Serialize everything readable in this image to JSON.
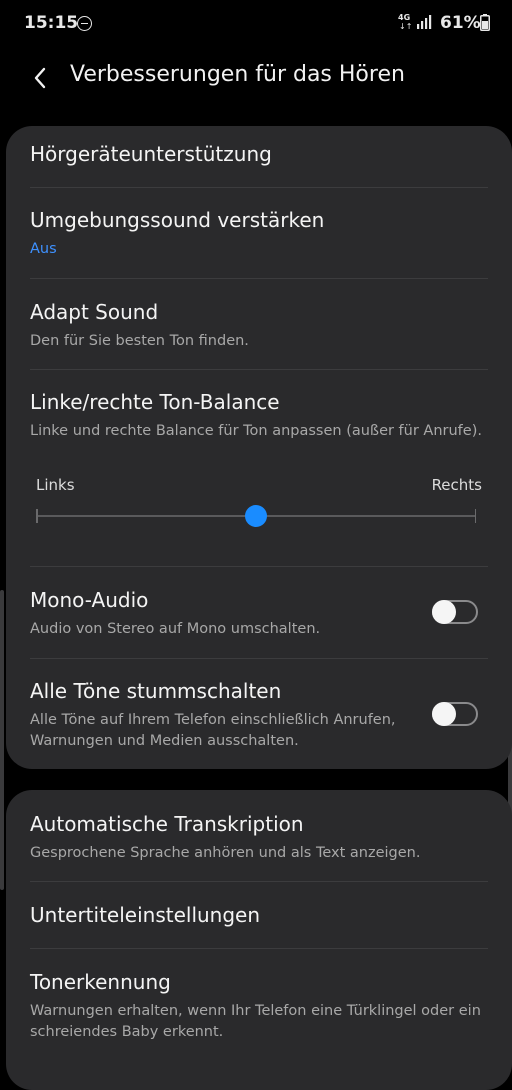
{
  "status_bar": {
    "time": "15:15",
    "network": "4G",
    "network_arrows": "↓↑",
    "battery": "61%",
    "icons": [
      "do-not-disturb-icon",
      "signal-icon",
      "battery-icon"
    ]
  },
  "header": {
    "title": "Verbesserungen für das Hören",
    "back_icon": "chevron-left-icon"
  },
  "card1": {
    "items": [
      {
        "title": "Hörgeräteunterstützung"
      },
      {
        "title": "Umgebungssound verstärken",
        "subtitle": "Aus"
      },
      {
        "title": "Adapt Sound",
        "subtitle": "Den für Sie besten Ton finden."
      },
      {
        "title": "Linke/rechte Ton-Balance",
        "subtitle": "Linke und rechte Balance für Ton anpassen (außer für Anrufe).",
        "slider": {
          "left_label": "Links",
          "right_label": "Rechts",
          "value": 0.5
        }
      },
      {
        "title": "Mono-Audio",
        "subtitle": "Audio von Stereo auf Mono umschalten.",
        "toggle": false
      },
      {
        "title": "Alle Töne stummschalten",
        "subtitle": "Alle Töne auf Ihrem Telefon einschließlich Anrufen, Warnungen und Medien ausschalten.",
        "toggle": false
      }
    ]
  },
  "card2": {
    "items": [
      {
        "title": "Automatische Transkription",
        "subtitle": "Gesprochene Sprache anhören und als Text anzeigen."
      },
      {
        "title": "Untertiteleinstellungen"
      },
      {
        "title": "Tonerkennung",
        "subtitle": "Warnungen erhalten, wenn Ihr Telefon eine Türklingel oder ein schreiendes Baby erkennt."
      }
    ]
  },
  "colors": {
    "background": "#000000",
    "card": "#2a2a2c",
    "accent": "#1a8cff",
    "link_blue": "#3e91ff",
    "secondary_text": "#a8a8a8"
  }
}
